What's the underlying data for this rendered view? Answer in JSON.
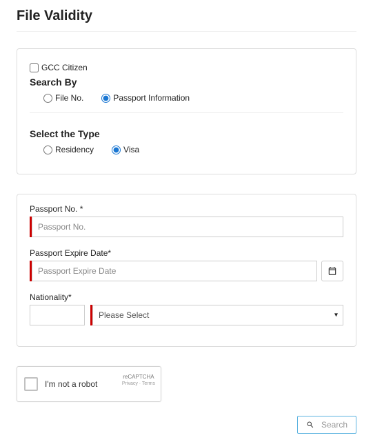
{
  "page": {
    "title": "File Validity"
  },
  "filter": {
    "gcc_label": "GCC Citizen",
    "search_by_title": "Search By",
    "search_by": {
      "file_no": "File No.",
      "passport_info": "Passport Information"
    },
    "select_type_title": "Select the Type",
    "type": {
      "residency": "Residency",
      "visa": "Visa"
    }
  },
  "form": {
    "passport_no_label": "Passport No. *",
    "passport_no_placeholder": "Passport No.",
    "expire_label": "Passport Expire Date*",
    "expire_placeholder": "Passport Expire Date",
    "nationality_label": "Nationality*",
    "nationality_select_placeholder": "Please Select"
  },
  "recaptcha": {
    "label": "I'm not a robot",
    "brand": "reCAPTCHA",
    "links": "Privacy · Terms"
  },
  "actions": {
    "search": "Search"
  }
}
